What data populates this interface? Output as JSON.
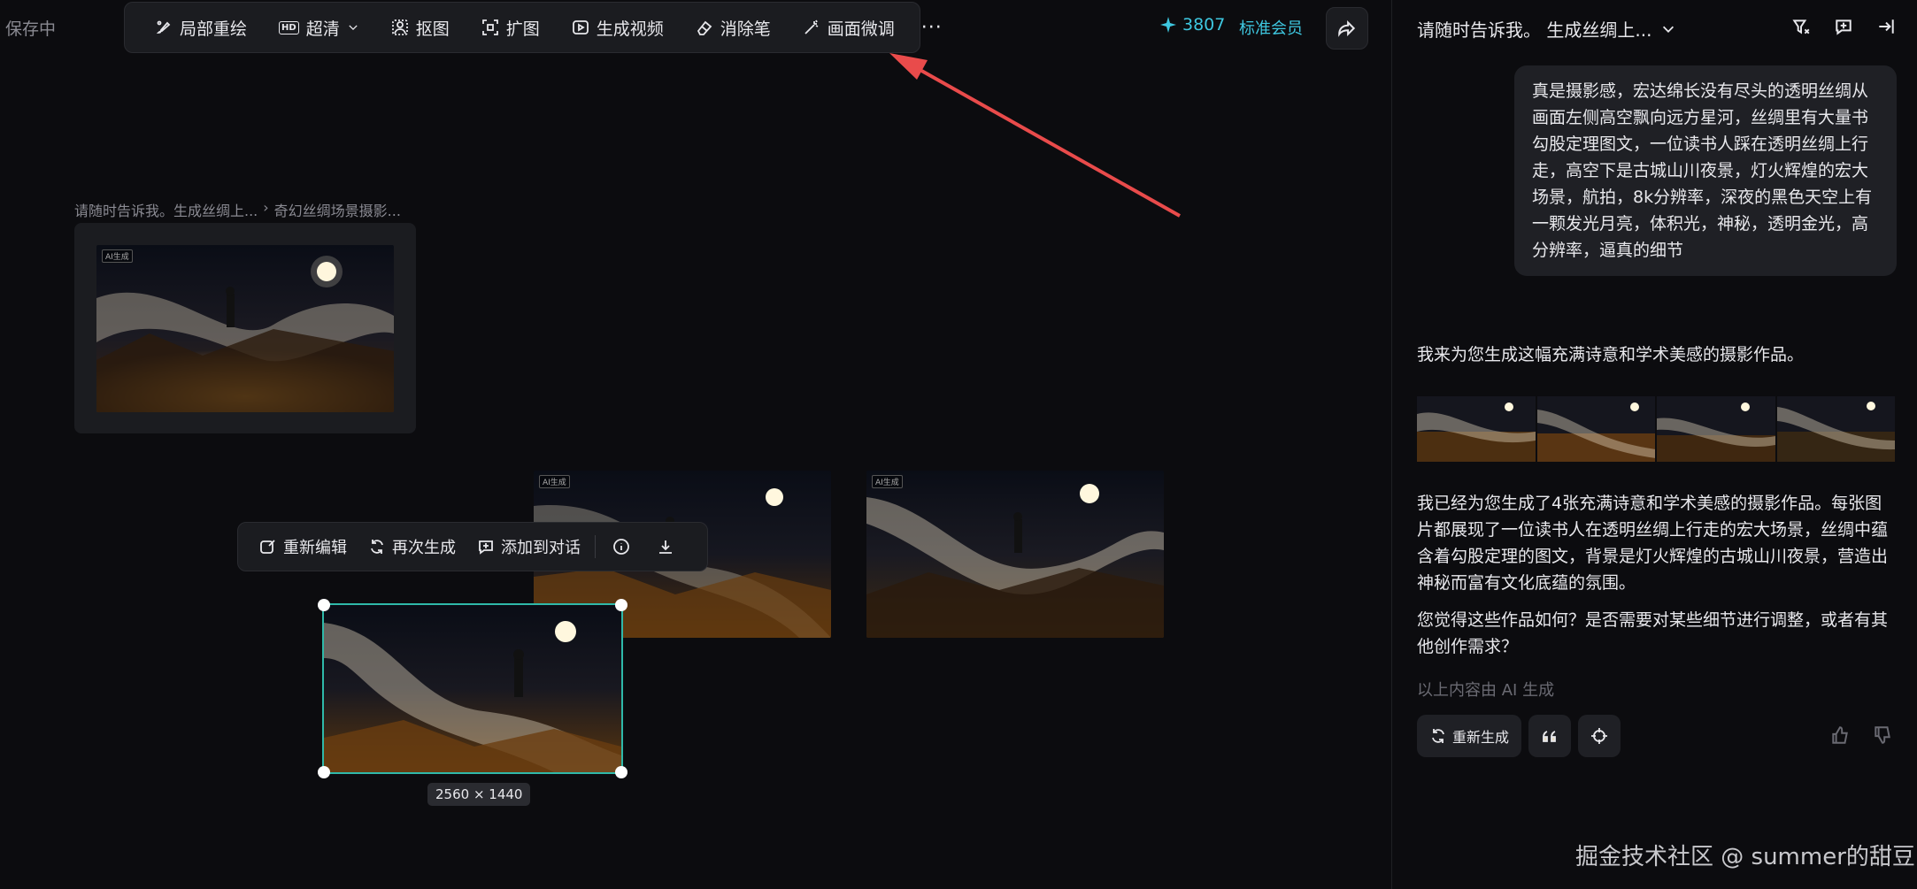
{
  "status": {
    "save": "保存中"
  },
  "toolbar": {
    "items": [
      {
        "label": "局部重绘",
        "icon": "brush-icon"
      },
      {
        "label": "超清",
        "icon": "hd-icon",
        "badge": "HD"
      },
      {
        "label": "抠图",
        "icon": "cutout-icon"
      },
      {
        "label": "扩图",
        "icon": "expand-icon"
      },
      {
        "label": "生成视频",
        "icon": "video-icon"
      },
      {
        "label": "消除笔",
        "icon": "eraser-icon"
      },
      {
        "label": "画面微调",
        "icon": "magic-wand-icon"
      }
    ],
    "more": "···"
  },
  "header": {
    "credits": "3807",
    "member": "标准会员"
  },
  "breadcrumb": {
    "first": "请随时告诉我。生成丝绸上...",
    "sep": "›",
    "second": "奇幻丝绸场景摄影..."
  },
  "image_tag": "AI生成",
  "image_toolbar": {
    "reedit": "重新编辑",
    "regen": "再次生成",
    "add_to_chat": "添加到对话"
  },
  "selection": {
    "dimensions": "2560 × 1440"
  },
  "panel": {
    "title": "请随时告诉我。 生成丝绸上...",
    "user_message": "真是摄影感，宏达绵长没有尽头的透明丝绸从画面左侧高空飘向远方星河，丝绸里有大量书勾股定理图文，一位读书人踩在透明丝绸上行走，高空下是古城山川夜景，灯火辉煌的宏大场景，航拍，8k分辨率，深夜的黑色天空上有一颗发光月亮，体积光，神秘，透明金光，高分辨率，逼真的细节",
    "ai_intro": "我来为您生成这幅充满诗意和学术美感的摄影作品。",
    "ai_summary": "我已经为您生成了4张充满诗意和学术美感的摄影作品。每张图片都展现了一位读书人在透明丝绸上行走的宏大场景，丝绸中蕴含着勾股定理的图文，背景是灯火辉煌的古城山川夜景，营造出神秘而富有文化底蕴的氛围。",
    "ai_question": "您觉得这些作品如何？是否需要对某些细节进行调整，或者有其他创作需求？",
    "ai_note": "以上内容由 AI 生成",
    "regen_label": "重新生成"
  },
  "watermark": "掘金技术社区 @ summer的甜豆",
  "colors": {
    "accent": "#3ec7e0",
    "selection": "#2fb9a9",
    "arrow": "#e94b4b"
  }
}
